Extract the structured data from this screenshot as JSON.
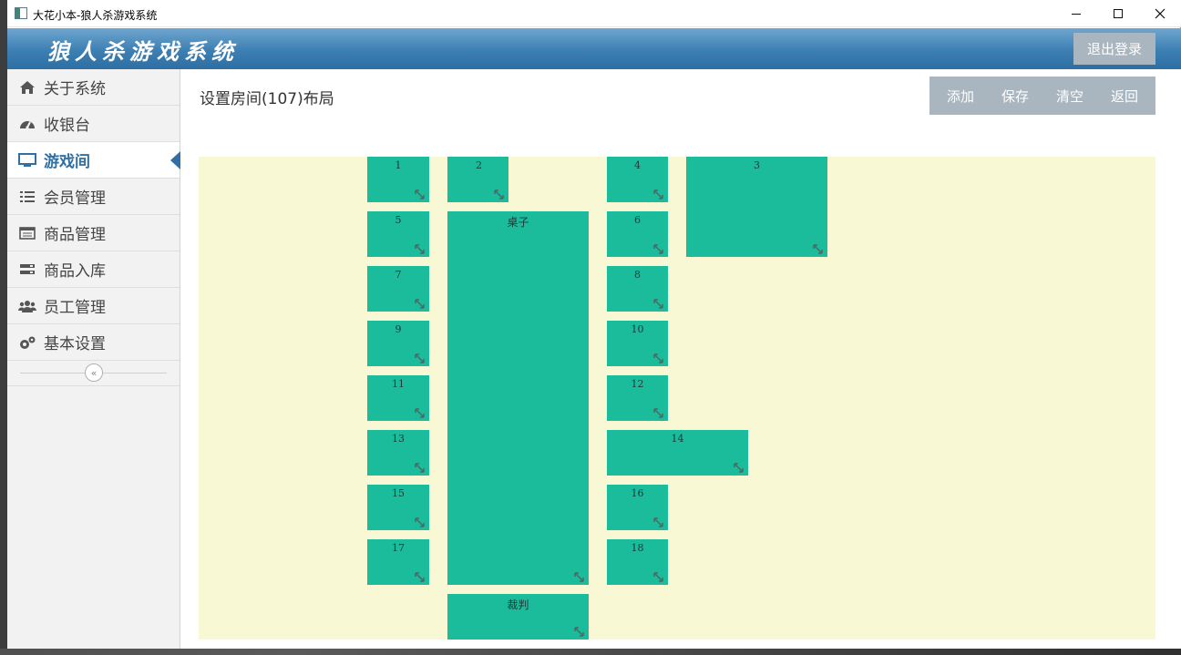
{
  "window": {
    "title": "大花小本-狼人杀游戏系统"
  },
  "header": {
    "brand": "狼人杀游戏系统",
    "logout_label": "退出登录"
  },
  "sidebar": {
    "items": [
      {
        "label": "关于系统",
        "icon": "home-icon"
      },
      {
        "label": "收银台",
        "icon": "dashboard-icon"
      },
      {
        "label": "游戏间",
        "icon": "monitor-icon",
        "active": true
      },
      {
        "label": "会员管理",
        "icon": "list-icon"
      },
      {
        "label": "商品管理",
        "icon": "table-icon"
      },
      {
        "label": "商品入库",
        "icon": "server-icon"
      },
      {
        "label": "员工管理",
        "icon": "users-icon"
      },
      {
        "label": "基本设置",
        "icon": "gears-icon"
      }
    ],
    "collapse_icon": "double-chevron-left-icon"
  },
  "main": {
    "page_title": "设置房间(107)布局",
    "toolbar": {
      "add": "添加",
      "save": "保存",
      "clear": "清空",
      "back": "返回"
    }
  },
  "layout": {
    "blocks": [
      {
        "label": "1"
      },
      {
        "label": "2"
      },
      {
        "label": "4"
      },
      {
        "label": "3"
      },
      {
        "label": "5"
      },
      {
        "label": "桌子"
      },
      {
        "label": "6"
      },
      {
        "label": "7"
      },
      {
        "label": "8"
      },
      {
        "label": "9"
      },
      {
        "label": "10"
      },
      {
        "label": "11"
      },
      {
        "label": "12"
      },
      {
        "label": "13"
      },
      {
        "label": "14"
      },
      {
        "label": "15"
      },
      {
        "label": "16"
      },
      {
        "label": "17"
      },
      {
        "label": "18"
      },
      {
        "label": "裁判"
      }
    ],
    "colors": {
      "canvas": "#f8f8d4",
      "block": "#1abc9c",
      "accent": "#2f6fa3"
    }
  }
}
